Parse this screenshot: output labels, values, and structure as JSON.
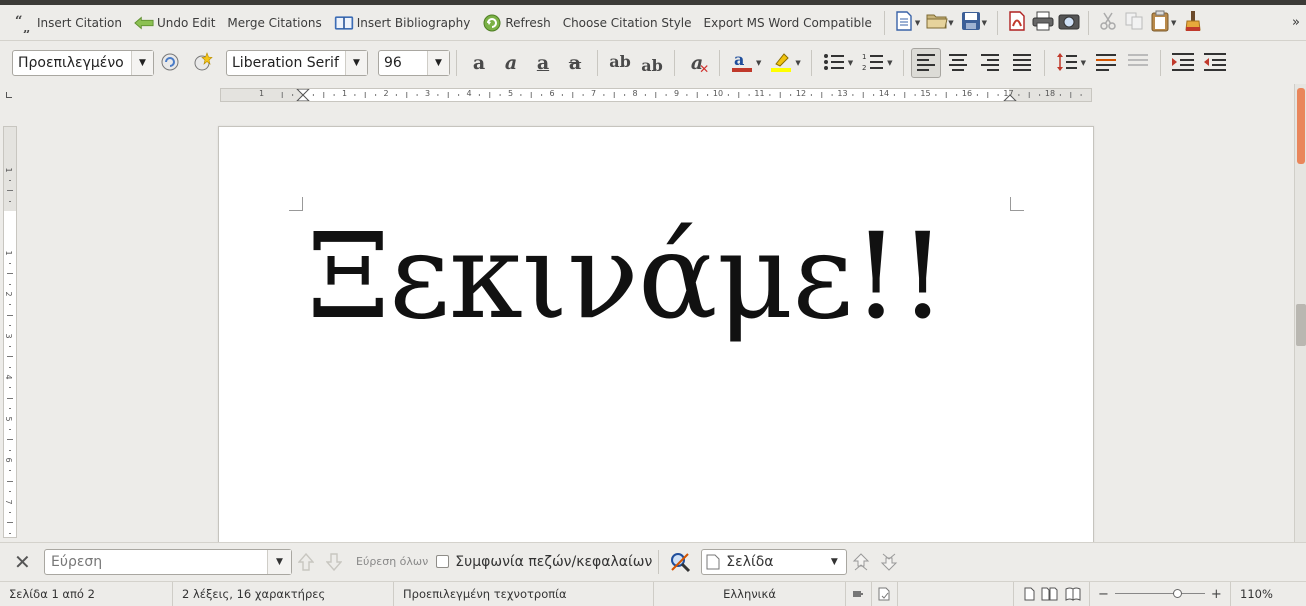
{
  "toolbar1": {
    "items": [
      {
        "label": "Insert Citation",
        "icon": "quote-icon"
      },
      {
        "label": "Undo Edit",
        "icon": "undo-arrow-icon"
      },
      {
        "label": "Merge Citations",
        "icon": ""
      },
      {
        "label": "Insert Bibliography",
        "icon": "book-icon"
      },
      {
        "label": "Refresh",
        "icon": "refresh-icon"
      },
      {
        "label": "Choose Citation Style",
        "icon": ""
      },
      {
        "label": "Export MS Word Compatible",
        "icon": ""
      }
    ],
    "more": "»"
  },
  "toolbar2": {
    "paragraph_style": "Προεπιλεγμένο",
    "font_name": "Liberation Serif",
    "font_size": "96",
    "format_glyphs": {
      "bold": "a",
      "italic": "a",
      "underline": "a",
      "strike": "a",
      "superscript": "ab",
      "subscript": "ab",
      "clear": "a"
    }
  },
  "ruler": {
    "labels": [
      "1",
      "1",
      "2",
      "3",
      "4",
      "5",
      "6",
      "7",
      "8",
      "9",
      "10",
      "11",
      "12",
      "13",
      "14",
      "15",
      "16",
      "17",
      "18"
    ],
    "vlabels": [
      "1",
      "1",
      "2",
      "3",
      "4",
      "5",
      "6",
      "7"
    ]
  },
  "document": {
    "text": "Ξεκινάμε!!"
  },
  "findbar": {
    "placeholder": "Εύρεση",
    "find_all": "Εύρεση όλων",
    "match_case": "Συμφωνία πεζών/κεφαλαίων",
    "search_by": "Σελίδα"
  },
  "statusbar": {
    "page": "Σελίδα 1 από 2",
    "words": "2 λέξεις, 16 χαρακτήρες",
    "style": "Προεπιλεγμένη τεχνοτροπία",
    "language": "Ελληνικά",
    "zoom": "110%"
  },
  "colors": {
    "font_color": "#1f4e9c",
    "highlight": "#ffff00",
    "scroll_thumb": "#e9865b"
  }
}
